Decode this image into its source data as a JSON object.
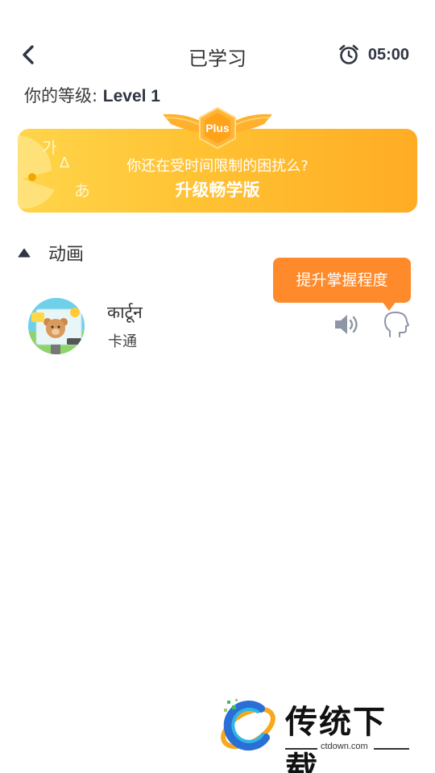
{
  "header": {
    "title": "已学习",
    "timer": "05:00",
    "back_icon": "chevron-left-icon",
    "timer_icon": "alarm-clock-icon"
  },
  "level": {
    "label": "你的等级:",
    "value": "Level 1"
  },
  "banner": {
    "badge": "Plus",
    "subtitle": "你还在受时间限制的困扰么?",
    "cta": "升级畅学版",
    "colors": {
      "start": "#ffd54a",
      "end": "#ffac24"
    }
  },
  "section": {
    "title": "动画",
    "caret_icon": "caret-up-icon"
  },
  "tooltip": {
    "text": "提升掌握程度",
    "color": "#ff8a2b"
  },
  "words": [
    {
      "term": "कार्टून",
      "meaning": "卡通",
      "thumb": "cartoon-bear-thumbnail",
      "speaker_icon": "speaker-icon",
      "speak_icon": "speaking-head-icon"
    }
  ],
  "watermark": {
    "name": "传统下载",
    "url": "ctdown.com"
  }
}
